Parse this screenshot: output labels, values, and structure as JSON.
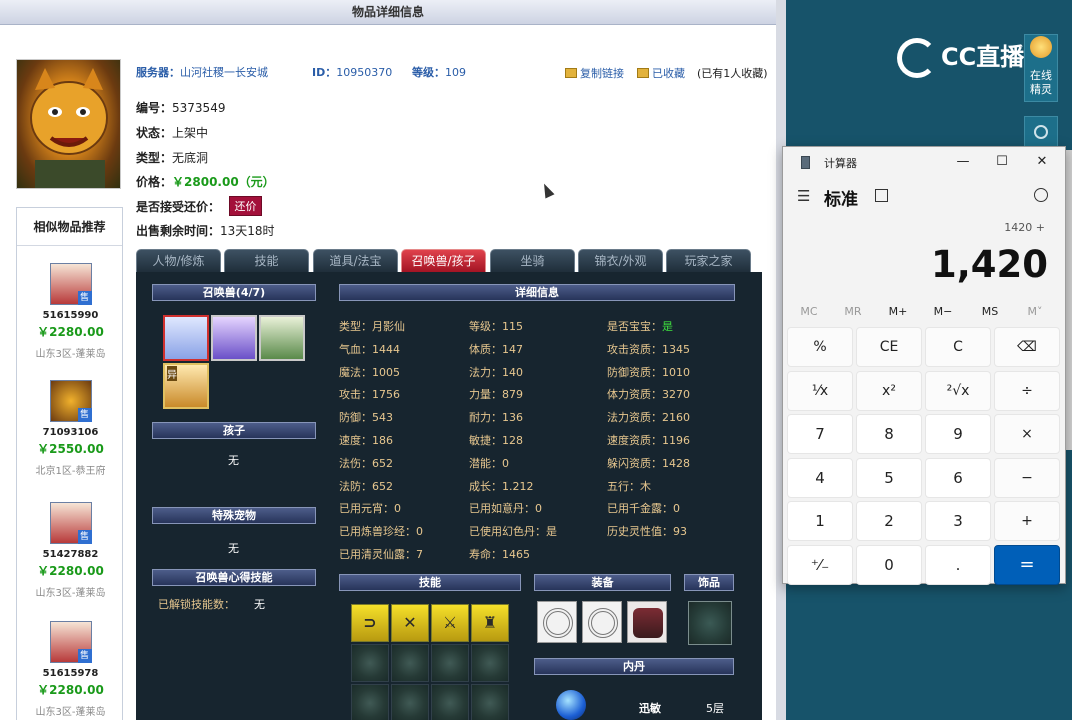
{
  "header": {
    "title": "物品详细信息"
  },
  "item": {
    "server_label": "服务器：",
    "server": "山河社稷一长安城",
    "id_label": "ID：",
    "id": "10950370",
    "level_label": "等级：",
    "level": "109",
    "copy_link": "复制链接",
    "favorited": "已收藏",
    "favorite_count": "(已有1人收藏)",
    "code_label": "编号：",
    "code": "5373549",
    "status_label": "状态：",
    "status": "上架中",
    "type_label": "类型：",
    "type": "无底洞",
    "price_label": "价格：",
    "price": "￥2800.00（元）",
    "bargain_label": "是否接受还价：",
    "bargain_btn": "还价",
    "time_label": "出售剩余时间：",
    "time": "13天18时"
  },
  "recommend": {
    "title": "相似物品推荐",
    "items": [
      {
        "id": "51615990",
        "price": "￥2280.00",
        "server": "山东3区-蓬莱岛",
        "sale": "售"
      },
      {
        "id": "71093106",
        "price": "￥2550.00",
        "server": "北京1区-恭王府",
        "sale": "售"
      },
      {
        "id": "51427882",
        "price": "￥2280.00",
        "server": "山东3区-蓬莱岛",
        "sale": "售"
      },
      {
        "id": "51615978",
        "price": "￥2280.00",
        "server": "山东3区-蓬莱岛",
        "sale": "售"
      }
    ]
  },
  "tabs": [
    "人物/修炼",
    "技能",
    "道具/法宝",
    "召唤兽/孩子",
    "坐骑",
    "锦衣/外观",
    "玩家之家"
  ],
  "panel": {
    "pets_header": "召唤兽(4/7)",
    "children_header": "孩子",
    "children_value": "无",
    "special_header": "特殊宠物",
    "special_value": "无",
    "skill_header": "召唤兽心得技能",
    "unlock_label": "已解锁技能数：",
    "unlock_value": "无",
    "detail_header": "详细信息",
    "stats": [
      [
        "类型：月影仙",
        "等级：115",
        "是否宝宝：是"
      ],
      [
        "气血：1444",
        "体质：147",
        "攻击资质：1345"
      ],
      [
        "魔法：1005",
        "法力：140",
        "防御资质：1010"
      ],
      [
        "攻击：1756",
        "力量：879",
        "体力资质：3270"
      ],
      [
        "防御：543",
        "耐力：136",
        "法力资质：2160"
      ],
      [
        "速度：186",
        "敏捷：128",
        "速度资质：1196"
      ],
      [
        "法伤：652",
        "潜能：0",
        "躲闪资质：1428"
      ],
      [
        "法防：652",
        "成长：1.212",
        "五行：木"
      ],
      [
        "已用元宵：0",
        "已用如意丹：0",
        "已用千金露：0"
      ],
      [
        "已用炼兽珍经：0",
        "已使用幻色丹：是",
        "历史灵性值：93"
      ],
      [
        "已用清灵仙露：7",
        "寿命：1465",
        ""
      ]
    ],
    "skills_header": "技能",
    "equip_header": "装备",
    "ornament_header": "饰品",
    "inner_header": "内丹",
    "inner_name": "迅敏",
    "inner_level": "5层",
    "pet_badge": "异"
  },
  "stream": {
    "logo": "CC直播",
    "sprite_label": "在线\n精灵"
  },
  "calculator": {
    "title": "计算器",
    "mode": "标准",
    "expression": "1420 +",
    "display": "1,420",
    "memory": [
      "MC",
      "MR",
      "M+",
      "M−",
      "MS",
      "M˅"
    ],
    "keys": [
      [
        "%",
        "CE",
        "C",
        "⌫"
      ],
      [
        "¹⁄x",
        "x²",
        "²√x",
        "÷"
      ],
      [
        "7",
        "8",
        "9",
        "×"
      ],
      [
        "4",
        "5",
        "6",
        "−"
      ],
      [
        "1",
        "2",
        "3",
        "+"
      ],
      [
        "⁺⁄₋",
        "0",
        ".",
        "="
      ]
    ]
  }
}
